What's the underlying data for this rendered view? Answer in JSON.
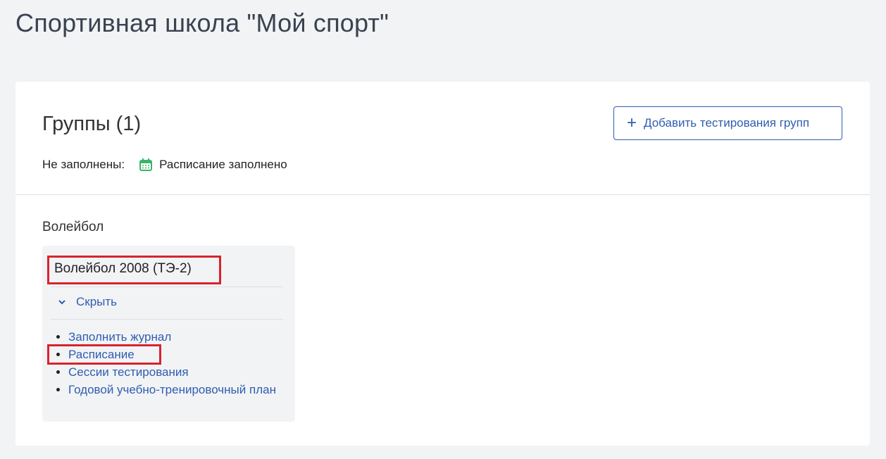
{
  "page": {
    "title": "Спортивная школа \"Мой спорт\""
  },
  "groups": {
    "title": "Группы (1)",
    "add_button_label": "Добавить тестирования групп",
    "filter_label": "Не заполнены:",
    "filter_chip_label": "Расписание заполнено",
    "filter_chip_icon": "calendar-icon",
    "section_label": "Волейбол",
    "group": {
      "name": "Волейбол 2008 (ТЭ-2)",
      "toggle_label": "Скрыть",
      "links": [
        "Заполнить журнал",
        "Расписание",
        "Сессии тестирования",
        "Годовой учебно-тренировочный план"
      ]
    }
  },
  "colors": {
    "accent": "#2f5db0",
    "highlight": "#d9232d",
    "calendar": "#3ab56a"
  }
}
